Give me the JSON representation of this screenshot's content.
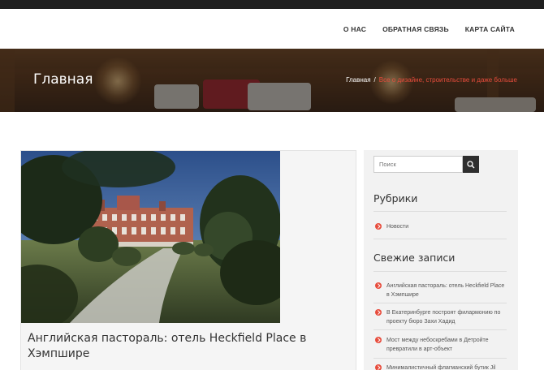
{
  "nav": {
    "items": [
      {
        "label": "О НАС"
      },
      {
        "label": "ОБРАТНАЯ СВЯЗЬ"
      },
      {
        "label": "КАРТА САЙТА"
      }
    ]
  },
  "banner": {
    "title": "Главная",
    "breadcrumb": {
      "home": "Главная",
      "separator": "/",
      "current": "Все о дизайне, строительстве и даже больше"
    }
  },
  "post": {
    "title": "Английская пастораль: отель Heckfield Place в Хэмпшире"
  },
  "sidebar": {
    "search": {
      "placeholder": "Поиск",
      "icon": "search-icon"
    },
    "rubrics": {
      "title": "Рубрики",
      "items": [
        {
          "label": "Новости"
        }
      ]
    },
    "recent": {
      "title": "Свежие записи",
      "items": [
        {
          "label": "Английская пастораль: отель Heckfield Place в Хэмпшире"
        },
        {
          "label": "В Екатеринбурге построят филармонию по проекту бюро Захи Хадид"
        },
        {
          "label": "Мост между небоскребами в Детройте превратили в арт-объект"
        },
        {
          "label": "Минималистичный флагманский бутик Jil"
        }
      ]
    }
  },
  "colors": {
    "accent": "#e74c3c",
    "topbar": "#1f1f1f",
    "sidebar_bg": "#f2f2f2"
  }
}
